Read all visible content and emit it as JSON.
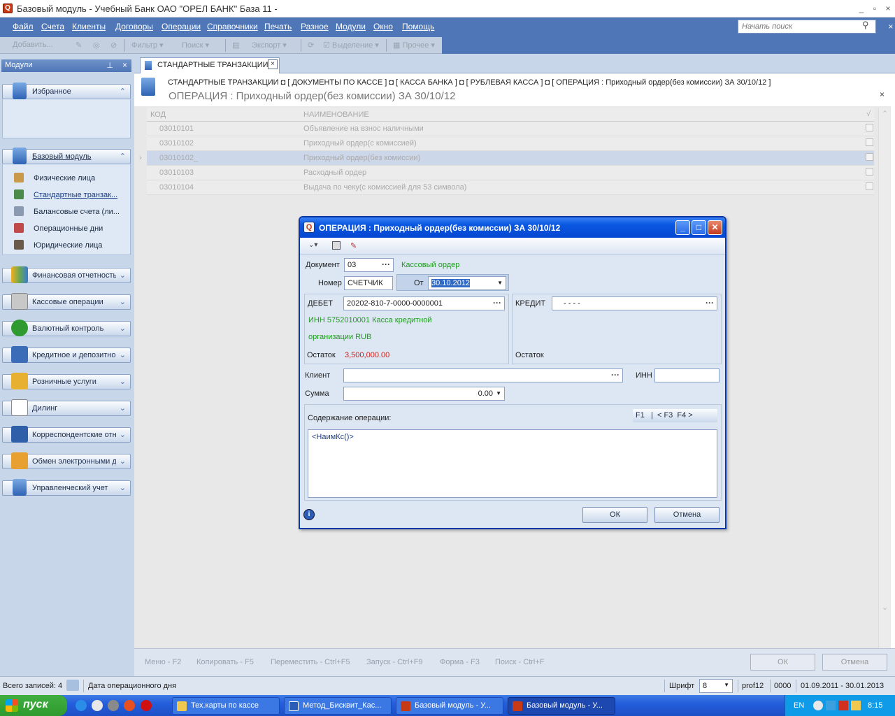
{
  "window": {
    "title": "Базовый модуль - Учебный Банк ОАО \"ОРЕЛ БАНК\" База 11 -",
    "app_icon": "Q",
    "min": "_",
    "max": "▫",
    "close": "×"
  },
  "menu": {
    "items": [
      "Файл",
      "Счета",
      "Клиенты",
      "Договоры",
      "Операции",
      "Справочники",
      "Печать",
      "Разное",
      "Модули",
      "Окно",
      "Помощь"
    ]
  },
  "search": {
    "placeholder": "Начать поиск"
  },
  "toolbar": {
    "items": [
      "Добавить...",
      "Фильтр",
      "Поиск",
      "Экспорт",
      "Выделение",
      "Прочее"
    ]
  },
  "sidebar": {
    "header": "Модули",
    "favorites": "Избранное",
    "base": "Базовый модуль",
    "base_items": [
      "Физические лица",
      "Стандартные транзак...",
      "Балансовые счета (ли...",
      "Операционные дни",
      "Юридические лица"
    ],
    "modules": [
      "Финансовая отчетность",
      "Кассовые операции",
      "Валютный контроль",
      "Кредитное и депозитное",
      "Розничные услуги",
      "Дилинг",
      "Корреспондентские отн",
      "Обмен электронными д",
      "Управленческий учет"
    ]
  },
  "tab": {
    "label": "СТАНДАРТНЫЕ ТРАНЗАКЦИИ",
    "close": "×"
  },
  "breadcrumb": "СТАНДАРТНЫЕ ТРАНЗАКЦИИ  ◘ [ ДОКУМЕНТЫ ПО КАССЕ ] ◘ [ КАССА БАНКА ] ◘ [ РУБЛЕВАЯ КАССА ] ◘ [ ОПЕРАЦИЯ : Приходный ордер(без комиссии) ЗА 30/10/12 ]",
  "page_title": "ОПЕРАЦИЯ : Приходный ордер(без комиссии) ЗА 30/10/12",
  "grid": {
    "headers": [
      "КОД",
      "НАИМЕНОВАНИЕ",
      "√"
    ],
    "rows": [
      {
        "code": "03010101",
        "name": "Объявление на взнос наличными"
      },
      {
        "code": "03010102",
        "name": "Приходный ордер(с комиссией)"
      },
      {
        "code": "03010102_",
        "name": "Приходный ордер(без комиссии)"
      },
      {
        "code": "03010103",
        "name": "Расходный ордер"
      },
      {
        "code": "03010104",
        "name": "Выдача по чеку(с комиссией для 53 символа)"
      }
    ]
  },
  "bottom": {
    "fkeys": [
      "Меню - F2",
      "Копировать - F5",
      "Переместить - Ctrl+F5",
      "Запуск - Ctrl+F9",
      "Форма - F3",
      "Поиск - Ctrl+F"
    ],
    "ok": "ОК",
    "cancel": "Отмена"
  },
  "status": {
    "records": "Всего записей: 4",
    "opday": "Дата операционного дня",
    "font_label": "Шрифт",
    "font_size": "8",
    "profile": "prof12",
    "code": "0000",
    "period": "01.09.2011 - 30.01.2013"
  },
  "taskbar": {
    "start": "пуск",
    "tasks": [
      "Тех.карты по кассе",
      "Метод_Бисквит_Кас...",
      "Базовый модуль - У...",
      "Базовый модуль - У..."
    ],
    "lang": "EN",
    "time": "8:15"
  },
  "dialog": {
    "title": "ОПЕРАЦИЯ : Приходный ордер(без комиссии) ЗА 30/10/12",
    "doc_label": "Документ",
    "doc_value": "03",
    "doc_name": "Кассовый ордер",
    "num_label": "Номер",
    "num_value": "СЧЕТЧИК",
    "date_label": "От",
    "date_value": "30.10.2012",
    "debit_label": "ДЕБЕТ",
    "debit_value": "20202-810-7-0000-0000001",
    "debit_desc1": "ИНН 5752010001 Касса кредитной",
    "debit_desc2": "организации RUB",
    "balance_label": "Остаток",
    "debit_balance": "3,500,000.00",
    "credit_label": "КРЕДИТ",
    "credit_value": "-  - -   -",
    "credit_balance_label": "Остаток",
    "client_label": "Клиент",
    "client_value": "",
    "inn_label": "ИНН",
    "inn_value": "",
    "sum_label": "Сумма",
    "sum_value": "0.00",
    "content_label": "Содержание операции:",
    "hotkeys": "F1   |  < F3  F4 >",
    "content_value": "<НаимКс()>",
    "ok": "ОК",
    "cancel": "Отмена"
  },
  "colors": {
    "menubar": "#4f77b8",
    "accent": "#0a57e2",
    "green_text": "#1f9a1f",
    "balance_red": "#d0201a"
  }
}
